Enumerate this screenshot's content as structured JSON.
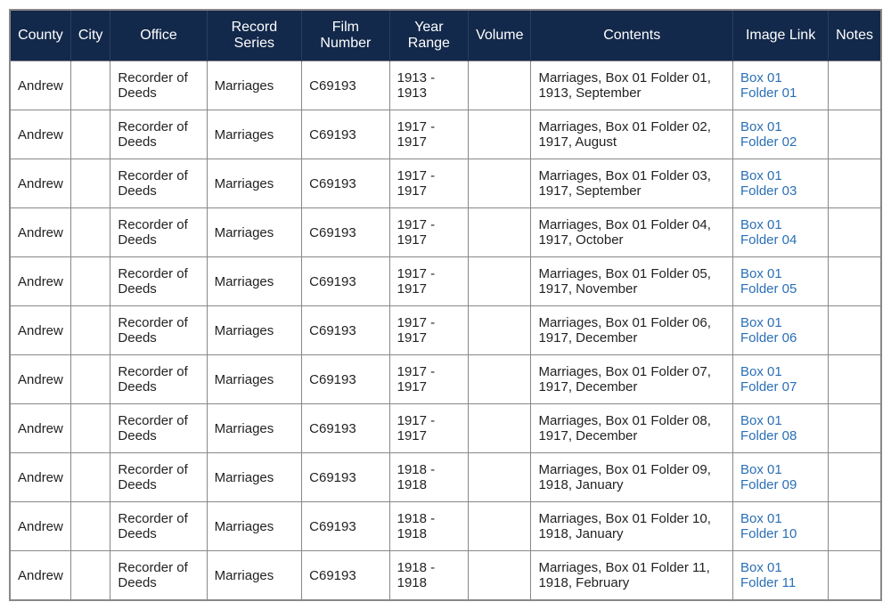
{
  "headers": {
    "county": "County",
    "city": "City",
    "office": "Office",
    "record_series": "Record Series",
    "film_number": "Film Number",
    "year_range": "Year Range",
    "volume": "Volume",
    "contents": "Contents",
    "image_link": "Image Link",
    "notes": "Notes"
  },
  "rows": [
    {
      "county": "Andrew",
      "city": "",
      "office": "Recorder of Deeds",
      "record_series": "Marriages",
      "film_number": "C69193",
      "year_range": "1913 - 1913",
      "volume": "",
      "contents": "Marriages, Box 01 Folder 01, 1913, September",
      "image_link": "Box 01 Folder 01",
      "notes": ""
    },
    {
      "county": "Andrew",
      "city": "",
      "office": "Recorder of Deeds",
      "record_series": "Marriages",
      "film_number": "C69193",
      "year_range": "1917 - 1917",
      "volume": "",
      "contents": "Marriages, Box 01 Folder 02, 1917, August",
      "image_link": "Box 01 Folder 02",
      "notes": ""
    },
    {
      "county": "Andrew",
      "city": "",
      "office": "Recorder of Deeds",
      "record_series": "Marriages",
      "film_number": "C69193",
      "year_range": "1917 - 1917",
      "volume": "",
      "contents": "Marriages, Box 01 Folder 03, 1917, September",
      "image_link": "Box 01 Folder 03",
      "notes": ""
    },
    {
      "county": "Andrew",
      "city": "",
      "office": "Recorder of Deeds",
      "record_series": "Marriages",
      "film_number": "C69193",
      "year_range": "1917 - 1917",
      "volume": "",
      "contents": "Marriages, Box 01 Folder 04, 1917, October",
      "image_link": "Box 01 Folder 04",
      "notes": ""
    },
    {
      "county": "Andrew",
      "city": "",
      "office": "Recorder of Deeds",
      "record_series": "Marriages",
      "film_number": "C69193",
      "year_range": "1917 - 1917",
      "volume": "",
      "contents": "Marriages, Box 01 Folder 05, 1917, November",
      "image_link": "Box 01 Folder 05",
      "notes": ""
    },
    {
      "county": "Andrew",
      "city": "",
      "office": "Recorder of Deeds",
      "record_series": "Marriages",
      "film_number": "C69193",
      "year_range": "1917 - 1917",
      "volume": "",
      "contents": "Marriages, Box 01 Folder 06, 1917, December",
      "image_link": "Box 01 Folder 06",
      "notes": ""
    },
    {
      "county": "Andrew",
      "city": "",
      "office": "Recorder of Deeds",
      "record_series": "Marriages",
      "film_number": "C69193",
      "year_range": "1917 - 1917",
      "volume": "",
      "contents": "Marriages, Box 01 Folder 07, 1917, December",
      "image_link": "Box 01 Folder 07",
      "notes": ""
    },
    {
      "county": "Andrew",
      "city": "",
      "office": "Recorder of Deeds",
      "record_series": "Marriages",
      "film_number": "C69193",
      "year_range": "1917 - 1917",
      "volume": "",
      "contents": "Marriages, Box 01 Folder 08, 1917, December",
      "image_link": "Box 01 Folder 08",
      "notes": ""
    },
    {
      "county": "Andrew",
      "city": "",
      "office": "Recorder of Deeds",
      "record_series": "Marriages",
      "film_number": "C69193",
      "year_range": "1918 - 1918",
      "volume": "",
      "contents": "Marriages, Box 01 Folder 09, 1918, January",
      "image_link": "Box 01 Folder 09",
      "notes": ""
    },
    {
      "county": "Andrew",
      "city": "",
      "office": "Recorder of Deeds",
      "record_series": "Marriages",
      "film_number": "C69193",
      "year_range": "1918 - 1918",
      "volume": "",
      "contents": "Marriages, Box 01 Folder 10, 1918, January",
      "image_link": "Box 01 Folder 10",
      "notes": ""
    },
    {
      "county": "Andrew",
      "city": "",
      "office": "Recorder of Deeds",
      "record_series": "Marriages",
      "film_number": "C69193",
      "year_range": "1918 - 1918",
      "volume": "",
      "contents": "Marriages, Box 01 Folder 11, 1918, February",
      "image_link": "Box 01 Folder 11",
      "notes": ""
    }
  ]
}
